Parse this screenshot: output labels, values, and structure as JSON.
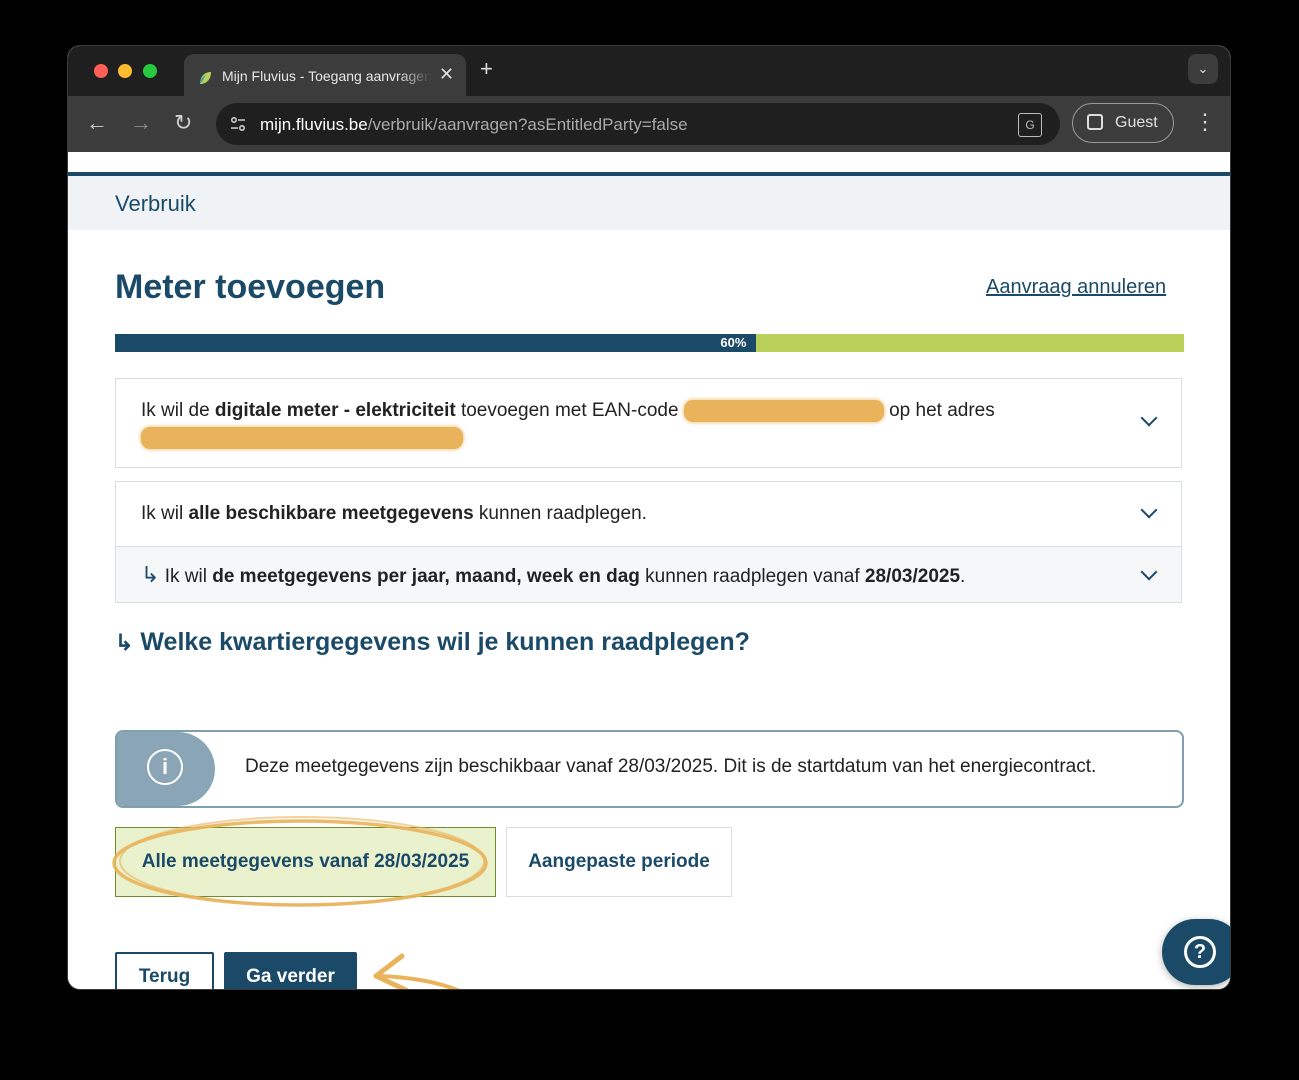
{
  "browser": {
    "tab_title": "Mijn Fluvius - Toegang aanvragen",
    "tab_close": "✕",
    "new_tab": "+",
    "tab_search": "⌄",
    "url_host": "mijn.fluvius.be",
    "url_path": "/verbruik/aanvragen?asEntitledParty=false",
    "profile_label": "Guest",
    "nav_back": "←",
    "nav_forward": "→",
    "nav_reload": "↻",
    "translate_glyph": "G",
    "menu_glyph": "⋮"
  },
  "breadcrumb": {
    "label": "Verbruik"
  },
  "page": {
    "title": "Meter toevoegen",
    "cancel_link": "Aanvraag annuleren",
    "progress": {
      "percent": 60,
      "label": "60%"
    }
  },
  "cards": {
    "meter": {
      "prefix": "Ik wil de ",
      "bold": "digitale meter - elektriciteit",
      "middle": " toevoegen met EAN-code ",
      "suffix": " op het adres"
    },
    "data": {
      "prefix": "Ik wil ",
      "bold": "alle beschikbare meetgegevens",
      "suffix": " kunnen raadplegen."
    },
    "periods": {
      "arrow": "↳",
      "prefix": " Ik wil ",
      "bold": "de meetgegevens per jaar, maand, week en dag",
      "middle": " kunnen raadplegen vanaf ",
      "date": "28/03/2025",
      "suffix": "."
    }
  },
  "question": {
    "arrow": "↳",
    "text": "Welke kwartiergegevens wil je kunnen raadplegen?"
  },
  "info": {
    "icon_glyph": "i",
    "text": "Deze meetgegevens zijn beschikbaar vanaf 28/03/2025. Dit is de startdatum van het energiecontract."
  },
  "options": {
    "all": "Alle meetgegevens vanaf 28/03/2025",
    "custom": "Aangepaste periode"
  },
  "buttons": {
    "back": "Terug",
    "next": "Ga verder"
  },
  "help": {
    "glyph": "?"
  },
  "colors": {
    "brand": "#1b4a68",
    "progress_rest": "#b9d059",
    "annotation": "#e9b35b",
    "selected_bg": "#eaf2cd"
  }
}
